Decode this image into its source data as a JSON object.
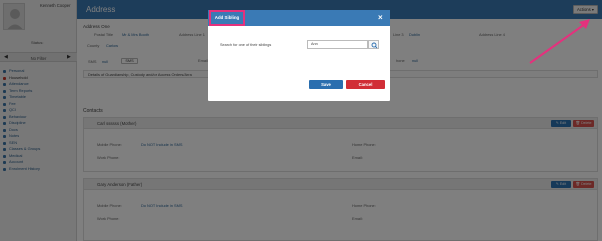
{
  "student": {
    "name": "Kenneth Cooper",
    "status_label": "Status:"
  },
  "filter": {
    "label": "No Filter"
  },
  "nav": {
    "items": [
      {
        "label": "Personal",
        "active": false
      },
      {
        "label": "Household",
        "active": true
      },
      {
        "label": "Attendance",
        "active": false
      },
      {
        "label": "Term Reports",
        "active": false
      },
      {
        "label": "Timetable",
        "active": false
      },
      {
        "label": "Fee",
        "active": false
      },
      {
        "label": "QCI",
        "active": false
      },
      {
        "label": "Behaviour",
        "active": false
      },
      {
        "label": "Discipline",
        "active": false
      },
      {
        "label": "Docs",
        "active": false
      },
      {
        "label": "Notes",
        "active": false
      },
      {
        "label": "SEN",
        "active": false
      },
      {
        "label": "Classes & Groups",
        "active": false
      },
      {
        "label": "Medical",
        "active": false
      },
      {
        "label": "Account",
        "active": false
      },
      {
        "label": "Enrolment History",
        "active": false
      }
    ]
  },
  "header": {
    "title": "Address",
    "actions_label": "Actions ▾"
  },
  "address": {
    "heading": "Address One",
    "postal_title_label": "Postal Title",
    "postal_title_value": "Mr & Mrs Booth",
    "address_line_1_label": "Address Line 1",
    "address_line_3_label": "Line 3",
    "address_line_3_value": "Dublin",
    "address_line_4_label": "Address Line 4",
    "county_label": "County",
    "county_value": "Carlow",
    "sms_label": "SMS",
    "sms_value": "null",
    "sms_button": "SMS",
    "email_label": "Email",
    "email_value": "null",
    "phone_suffix": "hone",
    "phone_value": "null",
    "details_label": "Details of Guardianship, Custody and/or Access Orders/Arra"
  },
  "contacts": {
    "heading": "Contacts",
    "edit_label": "Edit",
    "delete_label": "Delete",
    "mobile_label": "Mobile Phone:",
    "home_label": "Home Phone:",
    "work_label": "Work Phone:",
    "email_label": "Email:",
    "sms_note": "Do NOT Include in SMS",
    "cards": [
      {
        "name": "Carl ssssss (Mother)"
      },
      {
        "name": "Gary Anderson (Father)"
      }
    ]
  },
  "modal": {
    "title": "Add Sibling",
    "close": "×",
    "search_label": "Search for one of their siblings",
    "search_value": "Ann",
    "save_label": "Save",
    "cancel_label": "Cancel"
  },
  "colors": {
    "header": "#3a7ab5",
    "highlight": "#e4317d",
    "save": "#2a6eaf",
    "cancel": "#d12e36",
    "delete": "#d9534f"
  }
}
